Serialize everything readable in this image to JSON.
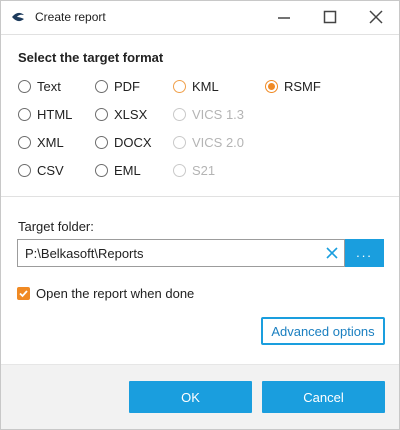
{
  "window": {
    "title": "Create report",
    "icon": "belkasoft-logo-icon"
  },
  "format": {
    "heading": "Select the target format",
    "options": [
      {
        "label": "Text",
        "state": "unchecked"
      },
      {
        "label": "PDF",
        "state": "unchecked"
      },
      {
        "label": "KML",
        "state": "unchecked-highlight"
      },
      {
        "label": "RSMF",
        "state": "checked"
      },
      {
        "label": "HTML",
        "state": "unchecked"
      },
      {
        "label": "XLSX",
        "state": "unchecked"
      },
      {
        "label": "VICS 1.3",
        "state": "disabled"
      },
      {
        "label": "XML",
        "state": "unchecked"
      },
      {
        "label": "DOCX",
        "state": "unchecked"
      },
      {
        "label": "VICS 2.0",
        "state": "disabled"
      },
      {
        "label": "CSV",
        "state": "unchecked"
      },
      {
        "label": "EML",
        "state": "unchecked"
      },
      {
        "label": "S21",
        "state": "disabled"
      }
    ],
    "selected": "RSMF"
  },
  "folder": {
    "label": "Target folder:",
    "value": "P:\\Belkasoft\\Reports",
    "browse_label": "..."
  },
  "open_when_done": {
    "label": "Open the report when done",
    "checked": true
  },
  "advanced_label": "Advanced options",
  "footer": {
    "ok_label": "OK",
    "cancel_label": "Cancel"
  },
  "colors": {
    "accent_blue": "#1a9ede",
    "accent_orange": "#f08a24",
    "disabled_gray": "#b4b4b4"
  }
}
